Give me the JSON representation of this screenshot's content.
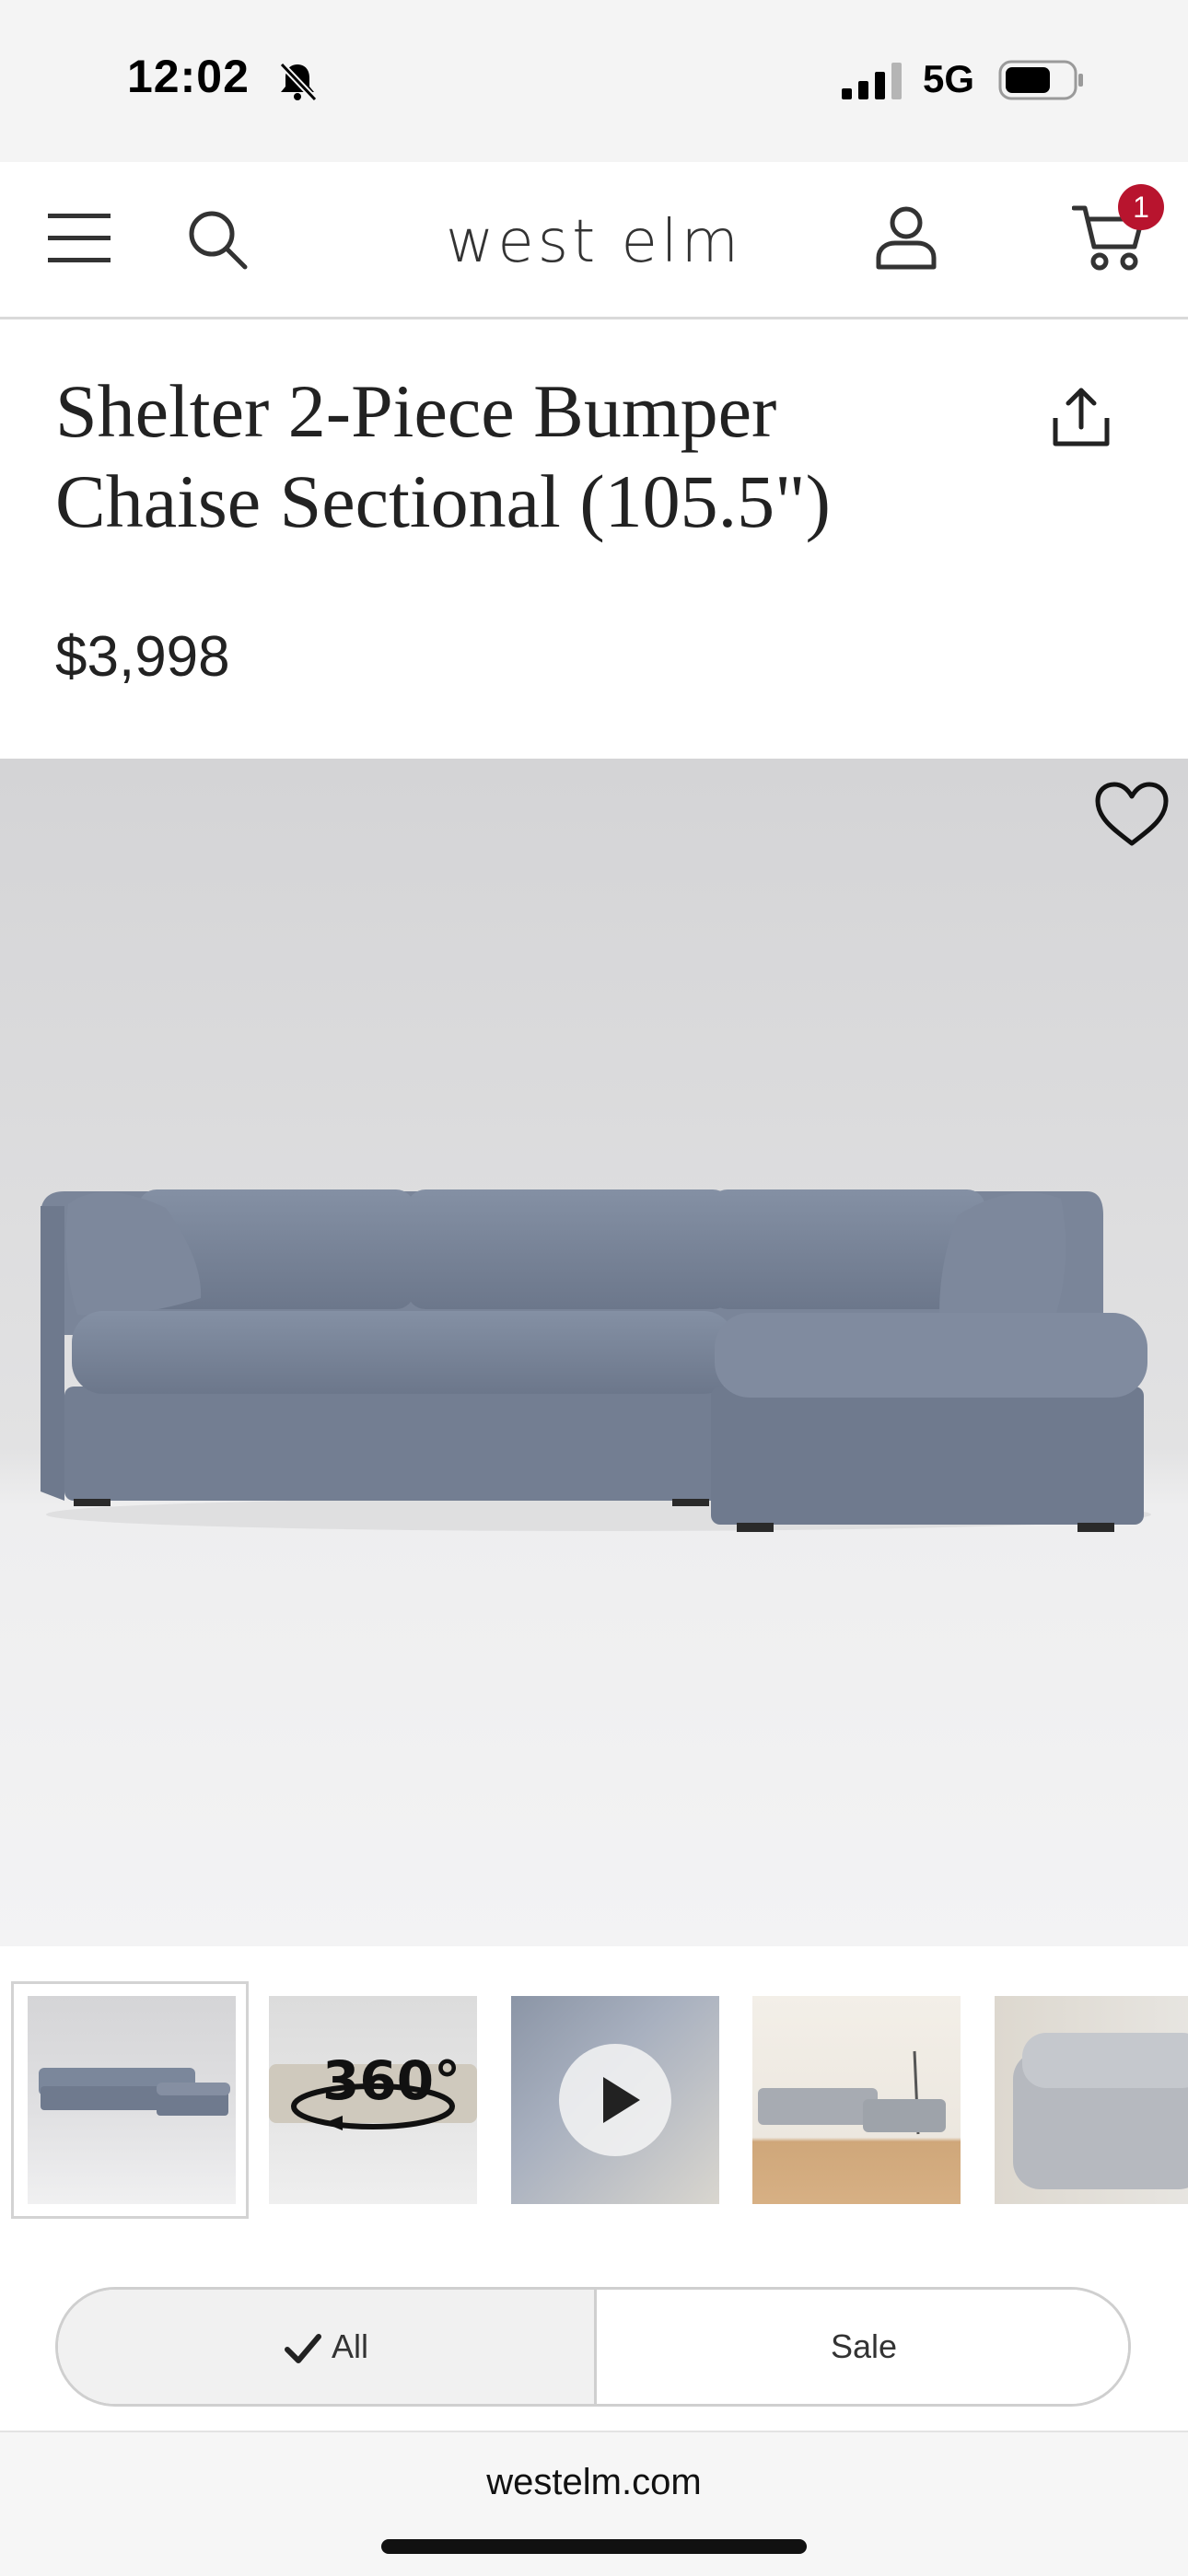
{
  "status_bar": {
    "time": "12:02",
    "network": "5G"
  },
  "nav": {
    "logo": "west elm",
    "cart_count": "1"
  },
  "product": {
    "title": "Shelter 2-Piece Bumper Chaise Sectional (105.5\")",
    "price": "$3,998"
  },
  "thumbnails": [
    {
      "label": "Gray sectional, studio view"
    },
    {
      "label": "360° view",
      "overlay": "360°"
    },
    {
      "label": "Video"
    },
    {
      "label": "Room scene"
    },
    {
      "label": "Detail view"
    }
  ],
  "filter": {
    "all_label": "All",
    "sale_label": "Sale",
    "selected": "All"
  },
  "browser": {
    "url": "westelm.com"
  },
  "colors": {
    "cart_badge": "#b8142e",
    "sofa": "#7b879c"
  }
}
